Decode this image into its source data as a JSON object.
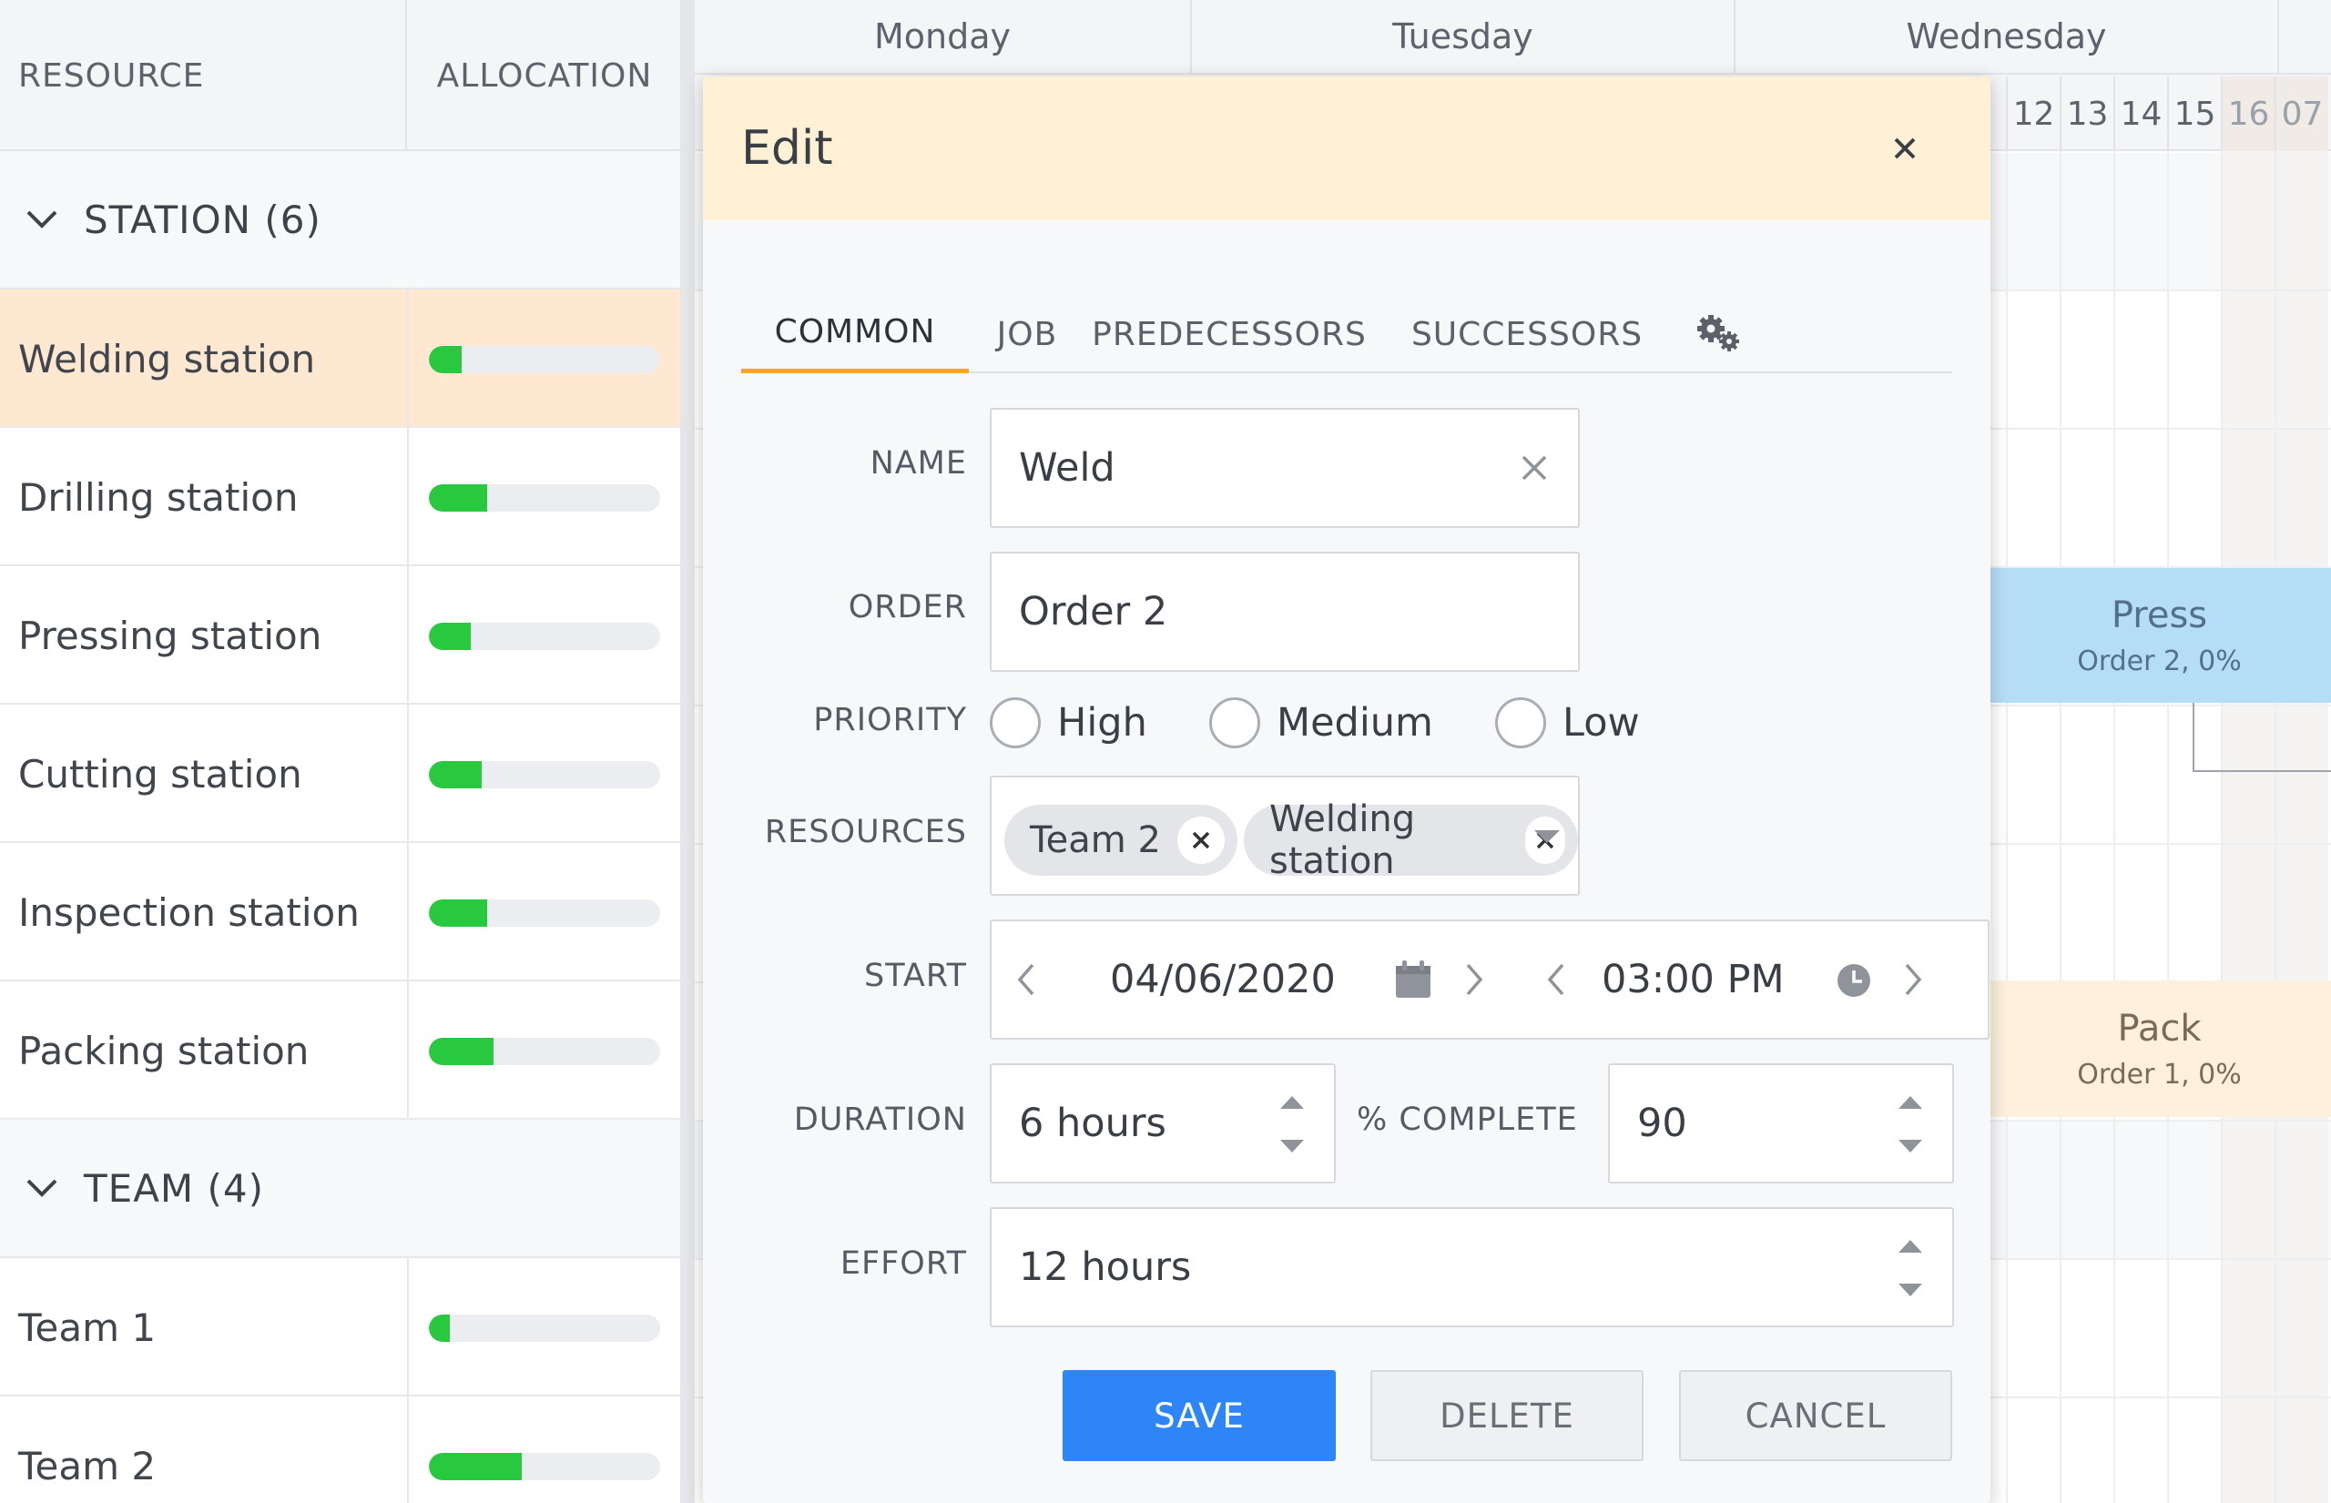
{
  "grid": {
    "headers": {
      "resource": "RESOURCE",
      "allocation": "ALLOCATION"
    },
    "groups": [
      {
        "label": "STATION (6)"
      },
      {
        "label": "TEAM (4)"
      }
    ],
    "rows": [
      {
        "name": "Welding station",
        "allocation": 0.14,
        "selected": true
      },
      {
        "name": "Drilling station",
        "allocation": 0.25
      },
      {
        "name": "Pressing station",
        "allocation": 0.18
      },
      {
        "name": "Cutting station",
        "allocation": 0.23
      },
      {
        "name": "Inspection station",
        "allocation": 0.25
      },
      {
        "name": "Packing station",
        "allocation": 0.28
      },
      {
        "name": "Team 1",
        "allocation": 0.09
      },
      {
        "name": "Team 2",
        "allocation": 0.4
      }
    ],
    "colors": {
      "bar_fill": "#28c93f",
      "selected_row": "#ffe8d1"
    }
  },
  "timeline": {
    "days": [
      "Monday",
      "Tuesday",
      "Wednesday"
    ],
    "hours": [
      "12",
      "13",
      "14",
      "15",
      "16",
      "07"
    ],
    "events": {
      "press": {
        "name": "Press",
        "sub": "Order 2, 0%"
      },
      "pack": {
        "name": "Pack",
        "sub": "Order 1, 0%"
      }
    }
  },
  "dialog": {
    "title": "Edit",
    "close_icon": "close-icon",
    "tabs": [
      "COMMON",
      "JOB",
      "PREDECESSORS",
      "SUCCESSORS"
    ],
    "active_tab": "COMMON",
    "settings_icon": "gears-icon",
    "fields": {
      "name": {
        "label": "NAME",
        "value": "Weld"
      },
      "order": {
        "label": "ORDER",
        "value": "Order 2"
      },
      "priority": {
        "label": "PRIORITY",
        "options": [
          "High",
          "Medium",
          "Low"
        ],
        "selected": null
      },
      "resources": {
        "label": "RESOURCES",
        "chips": [
          "Team 2",
          "Welding station"
        ]
      },
      "start": {
        "label": "START",
        "date": "04/06/2020",
        "time": "03:00 PM"
      },
      "duration": {
        "label": "DURATION",
        "value": "6 hours"
      },
      "percent_complete": {
        "label": "% COMPLETE",
        "value": "90"
      },
      "effort": {
        "label": "EFFORT",
        "value": "12 hours"
      }
    },
    "buttons": {
      "save": "SAVE",
      "delete": "DELETE",
      "cancel": "CANCEL"
    },
    "colors": {
      "header_bg": "#fff0d6",
      "save_bg": "#2e85f6",
      "tab_underline": "#f5a623"
    }
  }
}
